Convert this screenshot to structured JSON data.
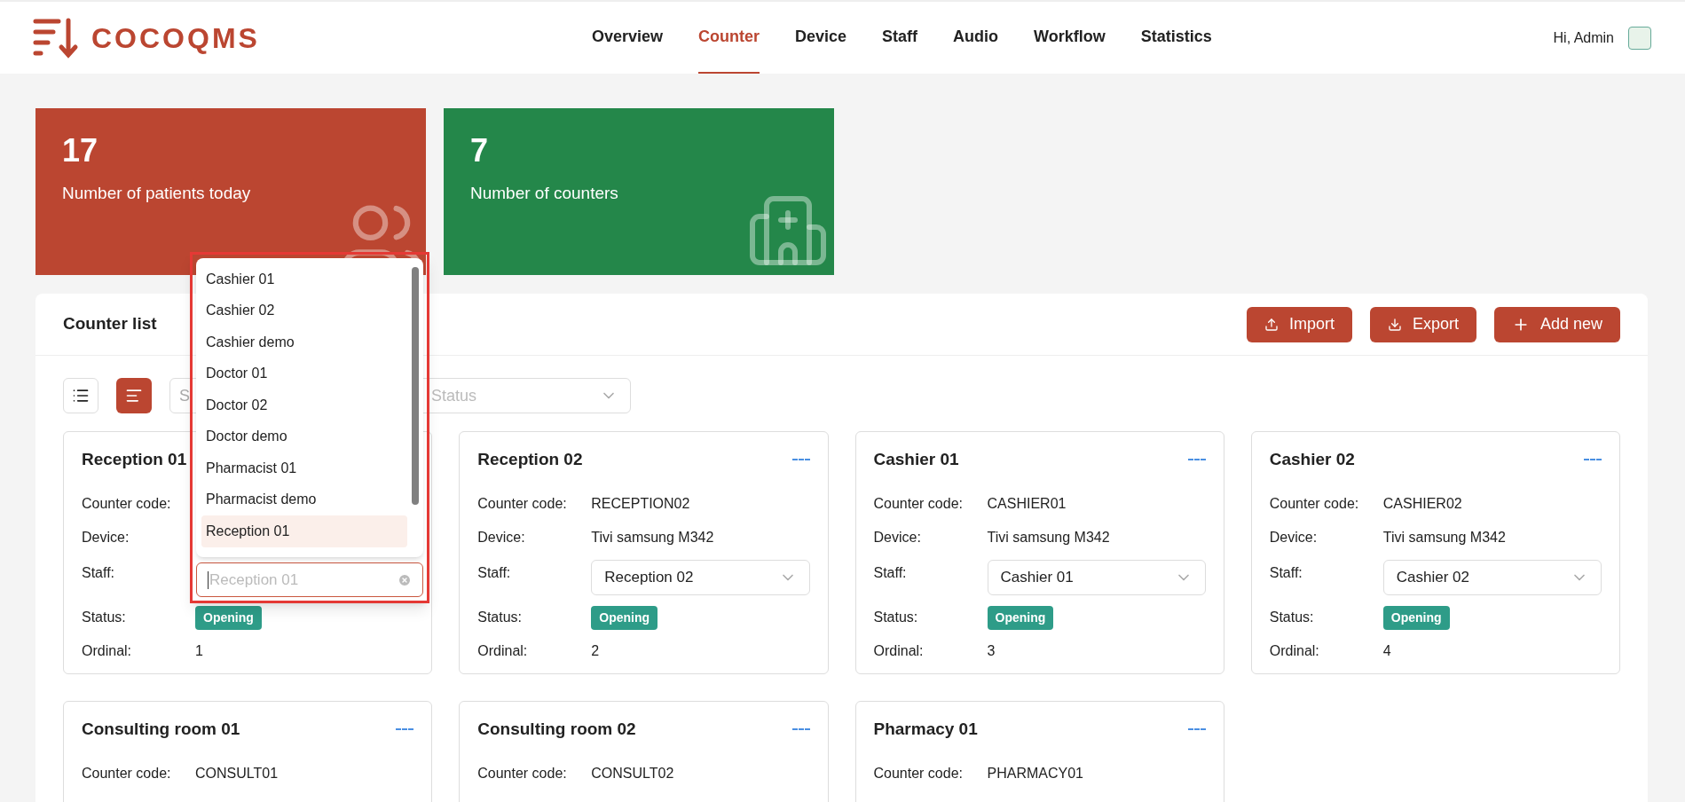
{
  "header": {
    "logo": "COCOQMS",
    "nav": [
      {
        "label": "Overview",
        "selected": false
      },
      {
        "label": "Counter",
        "selected": true
      },
      {
        "label": "Device",
        "selected": false
      },
      {
        "label": "Staff",
        "selected": false
      },
      {
        "label": "Audio",
        "selected": false
      },
      {
        "label": "Workflow",
        "selected": false
      },
      {
        "label": "Statistics",
        "selected": false
      }
    ],
    "greeting": "Hi, Admin"
  },
  "stats": [
    {
      "kind": "patients",
      "value": "17",
      "label": "Number of patients today",
      "color": "#bb4631"
    },
    {
      "kind": "counters",
      "value": "7",
      "label": "Number of counters",
      "color": "#24874a"
    }
  ],
  "panel": {
    "title": "Counter list",
    "buttons": [
      {
        "kind": "import",
        "label": "Import"
      },
      {
        "kind": "export",
        "label": "Export"
      },
      {
        "kind": "add",
        "label": "Add new"
      }
    ],
    "view_modes": [
      {
        "kind": "list",
        "selected": false
      },
      {
        "kind": "cards",
        "selected": true
      }
    ],
    "search_placeholder": "S",
    "status_placeholder": "Status",
    "counters": [
      {
        "title": "Reception 01",
        "rows": [
          {
            "kind": "text",
            "label": "Counter code:"
          },
          {
            "kind": "text",
            "label": "Device:"
          },
          {
            "kind": "select",
            "label": "Staff:"
          },
          {
            "kind": "badge",
            "label": "Status:",
            "value": "Opening"
          },
          {
            "kind": "text",
            "label": "Ordinal:",
            "value": "1"
          }
        ]
      },
      {
        "title": "Reception 02",
        "rows": [
          {
            "kind": "text",
            "label": "Counter code:",
            "value": "RECEPTION02"
          },
          {
            "kind": "text",
            "label": "Device:",
            "value": "Tivi samsung M342"
          },
          {
            "kind": "select",
            "label": "Staff:",
            "value": "Reception 02"
          },
          {
            "kind": "badge",
            "label": "Status:",
            "value": "Opening"
          },
          {
            "kind": "text",
            "label": "Ordinal:",
            "value": "2"
          }
        ]
      },
      {
        "title": "Cashier 01",
        "rows": [
          {
            "kind": "text",
            "label": "Counter code:",
            "value": "CASHIER01"
          },
          {
            "kind": "text",
            "label": "Device:",
            "value": "Tivi samsung M342"
          },
          {
            "kind": "select",
            "label": "Staff:",
            "value": "Cashier 01"
          },
          {
            "kind": "badge",
            "label": "Status:",
            "value": "Opening"
          },
          {
            "kind": "text",
            "label": "Ordinal:",
            "value": "3"
          }
        ]
      },
      {
        "title": "Cashier 02",
        "rows": [
          {
            "kind": "text",
            "label": "Counter code:",
            "value": "CASHIER02"
          },
          {
            "kind": "text",
            "label": "Device:",
            "value": "Tivi samsung M342"
          },
          {
            "kind": "select",
            "label": "Staff:",
            "value": "Cashier 02"
          },
          {
            "kind": "badge",
            "label": "Status:",
            "value": "Opening"
          },
          {
            "kind": "text",
            "label": "Ordinal:",
            "value": "4"
          }
        ]
      },
      {
        "title": "Consulting room 01",
        "rows": [
          {
            "kind": "text",
            "label": "Counter code:",
            "value": "CONSULT01"
          }
        ]
      },
      {
        "title": "Consulting room 02",
        "rows": [
          {
            "kind": "text",
            "label": "Counter code:",
            "value": "CONSULT02"
          }
        ]
      },
      {
        "title": "Pharmacy 01",
        "rows": [
          {
            "kind": "text",
            "label": "Counter code:",
            "value": "PHARMACY01"
          }
        ]
      }
    ]
  },
  "dropdown": {
    "search_placeholder": "Reception 01",
    "options": [
      {
        "label": "Cashier 01",
        "selected": false
      },
      {
        "label": "Cashier 02",
        "selected": false
      },
      {
        "label": "Cashier demo",
        "selected": false
      },
      {
        "label": "Doctor 01",
        "selected": false
      },
      {
        "label": "Doctor 02",
        "selected": false
      },
      {
        "label": "Doctor demo",
        "selected": false
      },
      {
        "label": "Pharmacist 01",
        "selected": false
      },
      {
        "label": "Pharmacist demo",
        "selected": false
      },
      {
        "label": "Reception 01",
        "selected": true
      }
    ]
  }
}
